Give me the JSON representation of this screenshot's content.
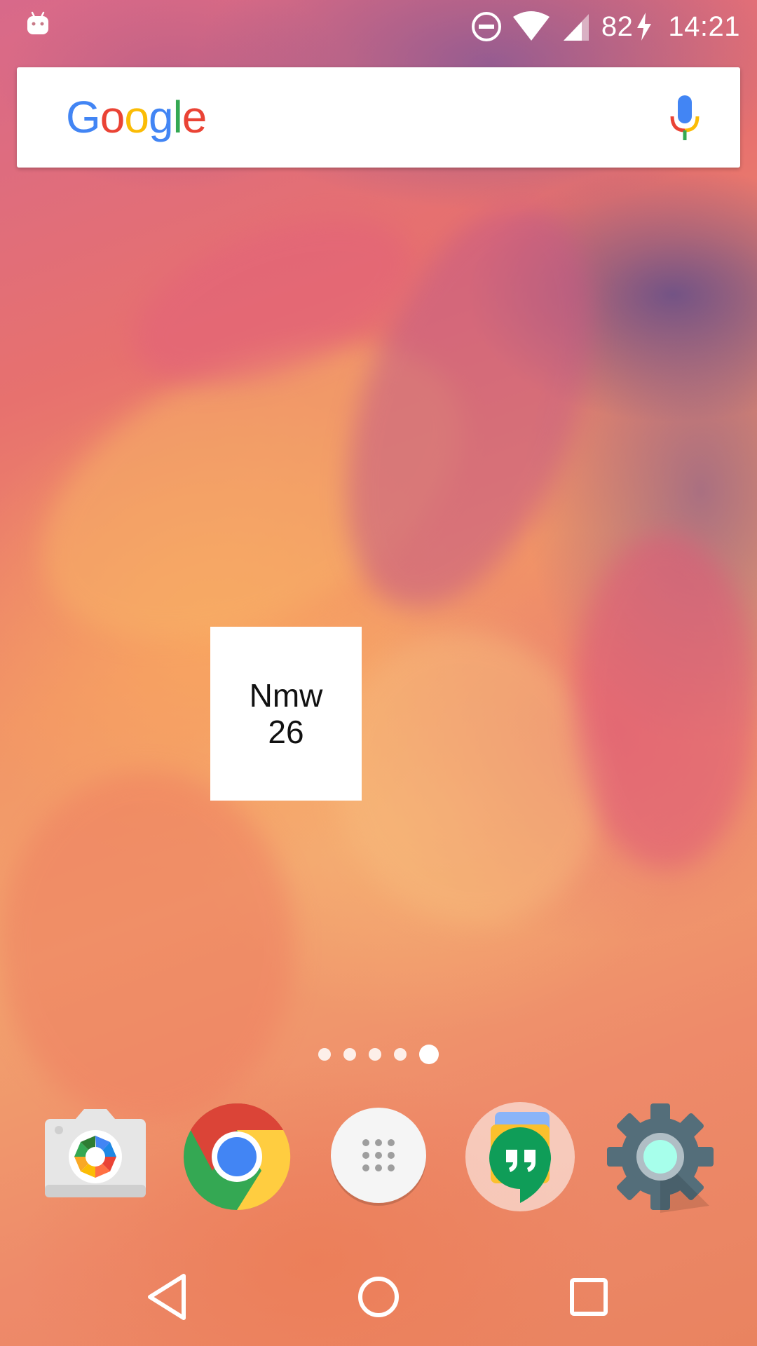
{
  "status_bar": {
    "notification_icon": "android-icon",
    "icons": [
      "do-not-disturb-icon",
      "wifi-icon",
      "signal-icon",
      "charging-bolt-icon"
    ],
    "battery": "82",
    "time": "14:21"
  },
  "search_bar": {
    "logo_letters": [
      "G",
      "o",
      "o",
      "g",
      "l",
      "e"
    ],
    "logo_colors": [
      "#4285F4",
      "#EA4335",
      "#FBBC05",
      "#4285F4",
      "#34A853",
      "#EA4335"
    ],
    "mic_icon": "mic-icon"
  },
  "widget": {
    "line1": "Nmw",
    "line2": "26"
  },
  "page_indicator": {
    "count": 5,
    "active_index": 4
  },
  "dock": {
    "apps": [
      {
        "name": "Camera",
        "icon": "camera-icon"
      },
      {
        "name": "Chrome",
        "icon": "chrome-icon"
      },
      {
        "name": "Apps",
        "icon": "app-drawer-icon"
      },
      {
        "name": "Hangouts",
        "icon": "hangouts-icon"
      },
      {
        "name": "Settings",
        "icon": "settings-gear-icon"
      }
    ]
  },
  "nav_bar": {
    "buttons": [
      "back-icon",
      "home-icon",
      "recents-icon"
    ]
  }
}
